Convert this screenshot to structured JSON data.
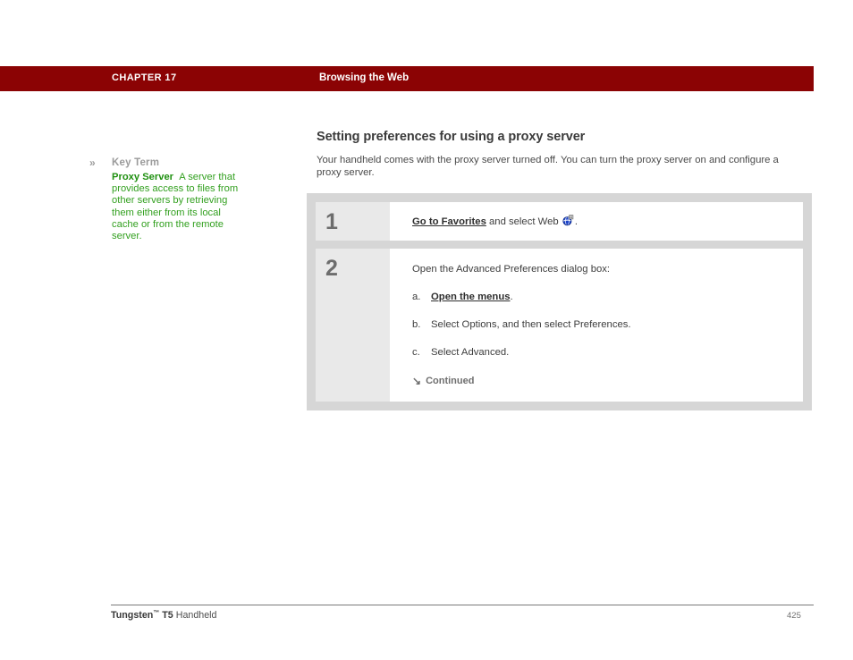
{
  "header": {
    "chapter": "CHAPTER 17",
    "title": "Browsing the Web",
    "bar_color": "#8b0304"
  },
  "sidebar": {
    "chevron_icon": "»",
    "label": "Key Term",
    "term": "Proxy Server",
    "definition": "A server that provides access to files from other servers by retrieving them either from its local cache or from the remote server.",
    "term_color": "#1f9010",
    "definition_color": "#33a020",
    "label_color": "#9b9b9b"
  },
  "main": {
    "heading": "Setting preferences for using a proxy server",
    "intro": "Your handheld comes with the proxy server turned off. You can turn the proxy server on and configure a proxy server."
  },
  "steps": [
    {
      "number": "1",
      "link_text": "Go to Favorites",
      "text_after_link": " and select Web ",
      "icon": "web-globe-icon",
      "text_end": "."
    },
    {
      "number": "2",
      "intro": "Open the Advanced Preferences dialog box:",
      "substeps": [
        {
          "marker": "a.",
          "link_text": "Open the menus",
          "text": ".",
          "is_link": true
        },
        {
          "marker": "b.",
          "text": "Select Options, and then select Preferences.",
          "is_link": false
        },
        {
          "marker": "c.",
          "text": "Select Advanced.",
          "is_link": false
        }
      ],
      "continued_arrow": "↘",
      "continued_label": "Continued"
    }
  ],
  "footer": {
    "product_bold": "Tungsten",
    "trademark": "™",
    "model": " T5",
    "product_rest": " Handheld",
    "page_number": "425"
  }
}
